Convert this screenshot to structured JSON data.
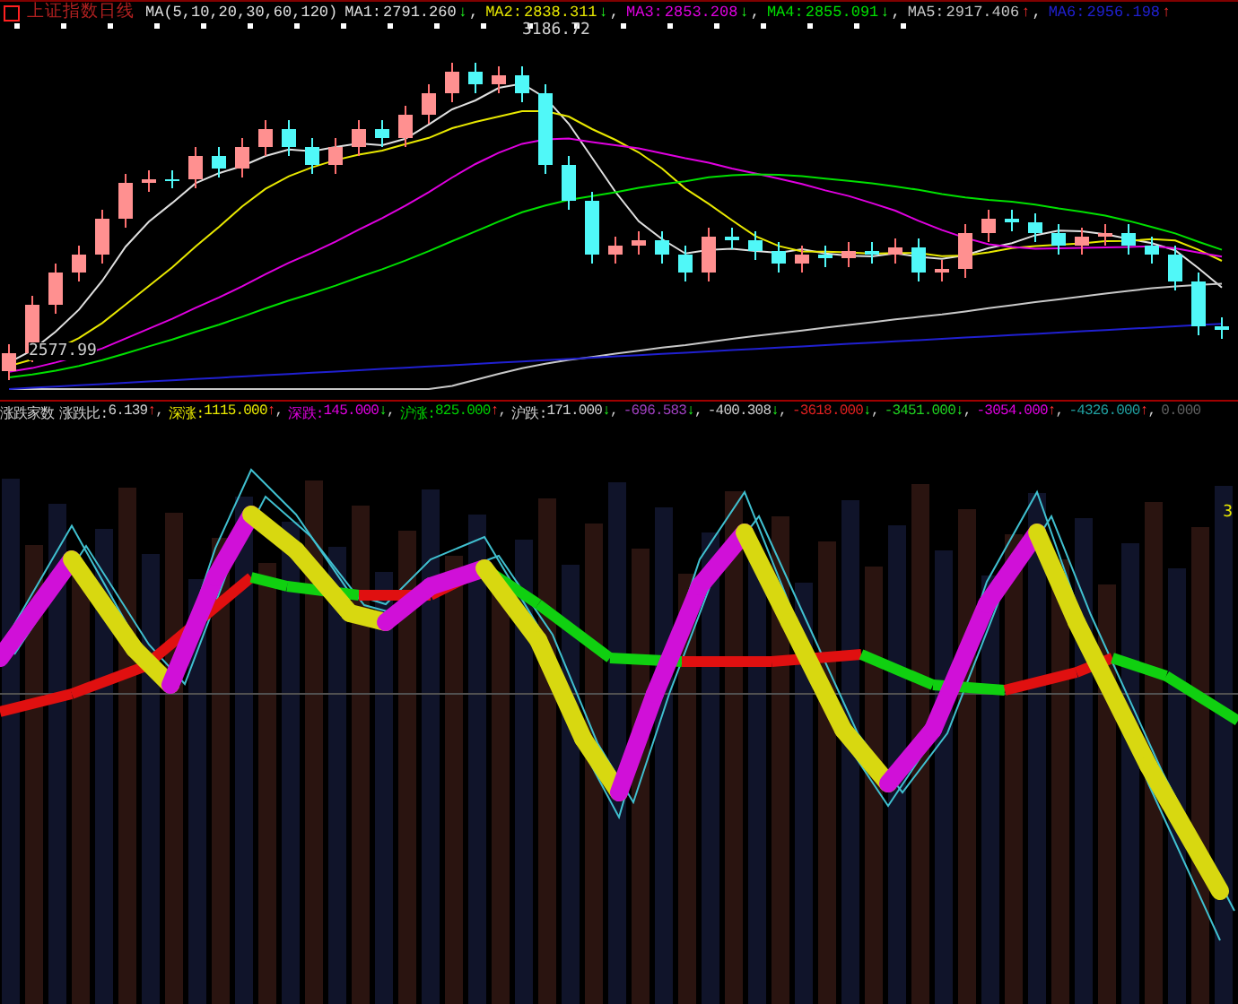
{
  "chart": {
    "title": "上证指数日线",
    "ma_setting": "MA(5,10,20,30,60,120)",
    "ma": [
      {
        "label": "MA1:",
        "value": "2791.260",
        "arrow": "↓",
        "rising": false,
        "sep": ",",
        "color": "#e0e0e0"
      },
      {
        "label": "MA2:",
        "value": "2838.311",
        "arrow": "↓",
        "rising": false,
        "sep": ",",
        "color": "#e8e800"
      },
      {
        "label": "MA3:",
        "value": "2853.208",
        "arrow": "↓",
        "rising": false,
        "sep": ",",
        "color": "#e000e0"
      },
      {
        "label": "MA4:",
        "value": "2855.091",
        "arrow": "↓",
        "rising": false,
        "sep": ",",
        "color": "#00e000"
      },
      {
        "label": "MA5:",
        "value": "2917.406",
        "arrow": "↑",
        "rising": true,
        "sep": ",",
        "color": "#c8c8c8"
      },
      {
        "label": "MA6:",
        "value": "2956.198",
        "arrow": "↑",
        "rising": true,
        "color": "#2020d0"
      }
    ],
    "high_label": "3186.72",
    "low_label": "2577.99"
  },
  "indicator": {
    "title": "涨跌家数",
    "items": [
      {
        "label": "涨跌比:",
        "value": "6.139",
        "arrow": "↑",
        "rising": true,
        "sep": ",",
        "color": "#d0d0d0"
      },
      {
        "label": "深涨:",
        "value": "1115.000",
        "arrow": "↑",
        "rising": true,
        "sep": ",",
        "color": "#e8e800"
      },
      {
        "label": "深跌:",
        "value": "145.000",
        "arrow": "↓",
        "rising": false,
        "sep": ",",
        "color": "#e000e0"
      },
      {
        "label": "沪涨:",
        "value": "825.000",
        "arrow": "↑",
        "rising": true,
        "sep": ",",
        "color": "#00d000"
      },
      {
        "label": "沪跌:",
        "value": "171.000",
        "arrow": "↓",
        "rising": false,
        "sep": ",",
        "color": "#d0d0d0"
      },
      {
        "value": "-696.583",
        "arrow": "↓",
        "rising": false,
        "sep": ",",
        "color": "#a040c0"
      },
      {
        "value": "-400.308",
        "arrow": "↓",
        "rising": false,
        "sep": ",",
        "color": "#d0d0d0"
      },
      {
        "value": "-3618.000",
        "arrow": "↓",
        "rising": false,
        "sep": ",",
        "color": "#e02020"
      },
      {
        "value": "-3451.000",
        "arrow": "↓",
        "rising": false,
        "sep": ",",
        "color": "#20d020"
      },
      {
        "value": "-3054.000",
        "arrow": "↑",
        "rising": true,
        "sep": ",",
        "color": "#e000e0"
      },
      {
        "value": "-4326.000",
        "arrow": "↑",
        "rising": true,
        "sep": ",",
        "color": "#20a0a0"
      },
      {
        "value": "0.000",
        "color": "#606060"
      }
    ],
    "scale_label": "3"
  }
}
